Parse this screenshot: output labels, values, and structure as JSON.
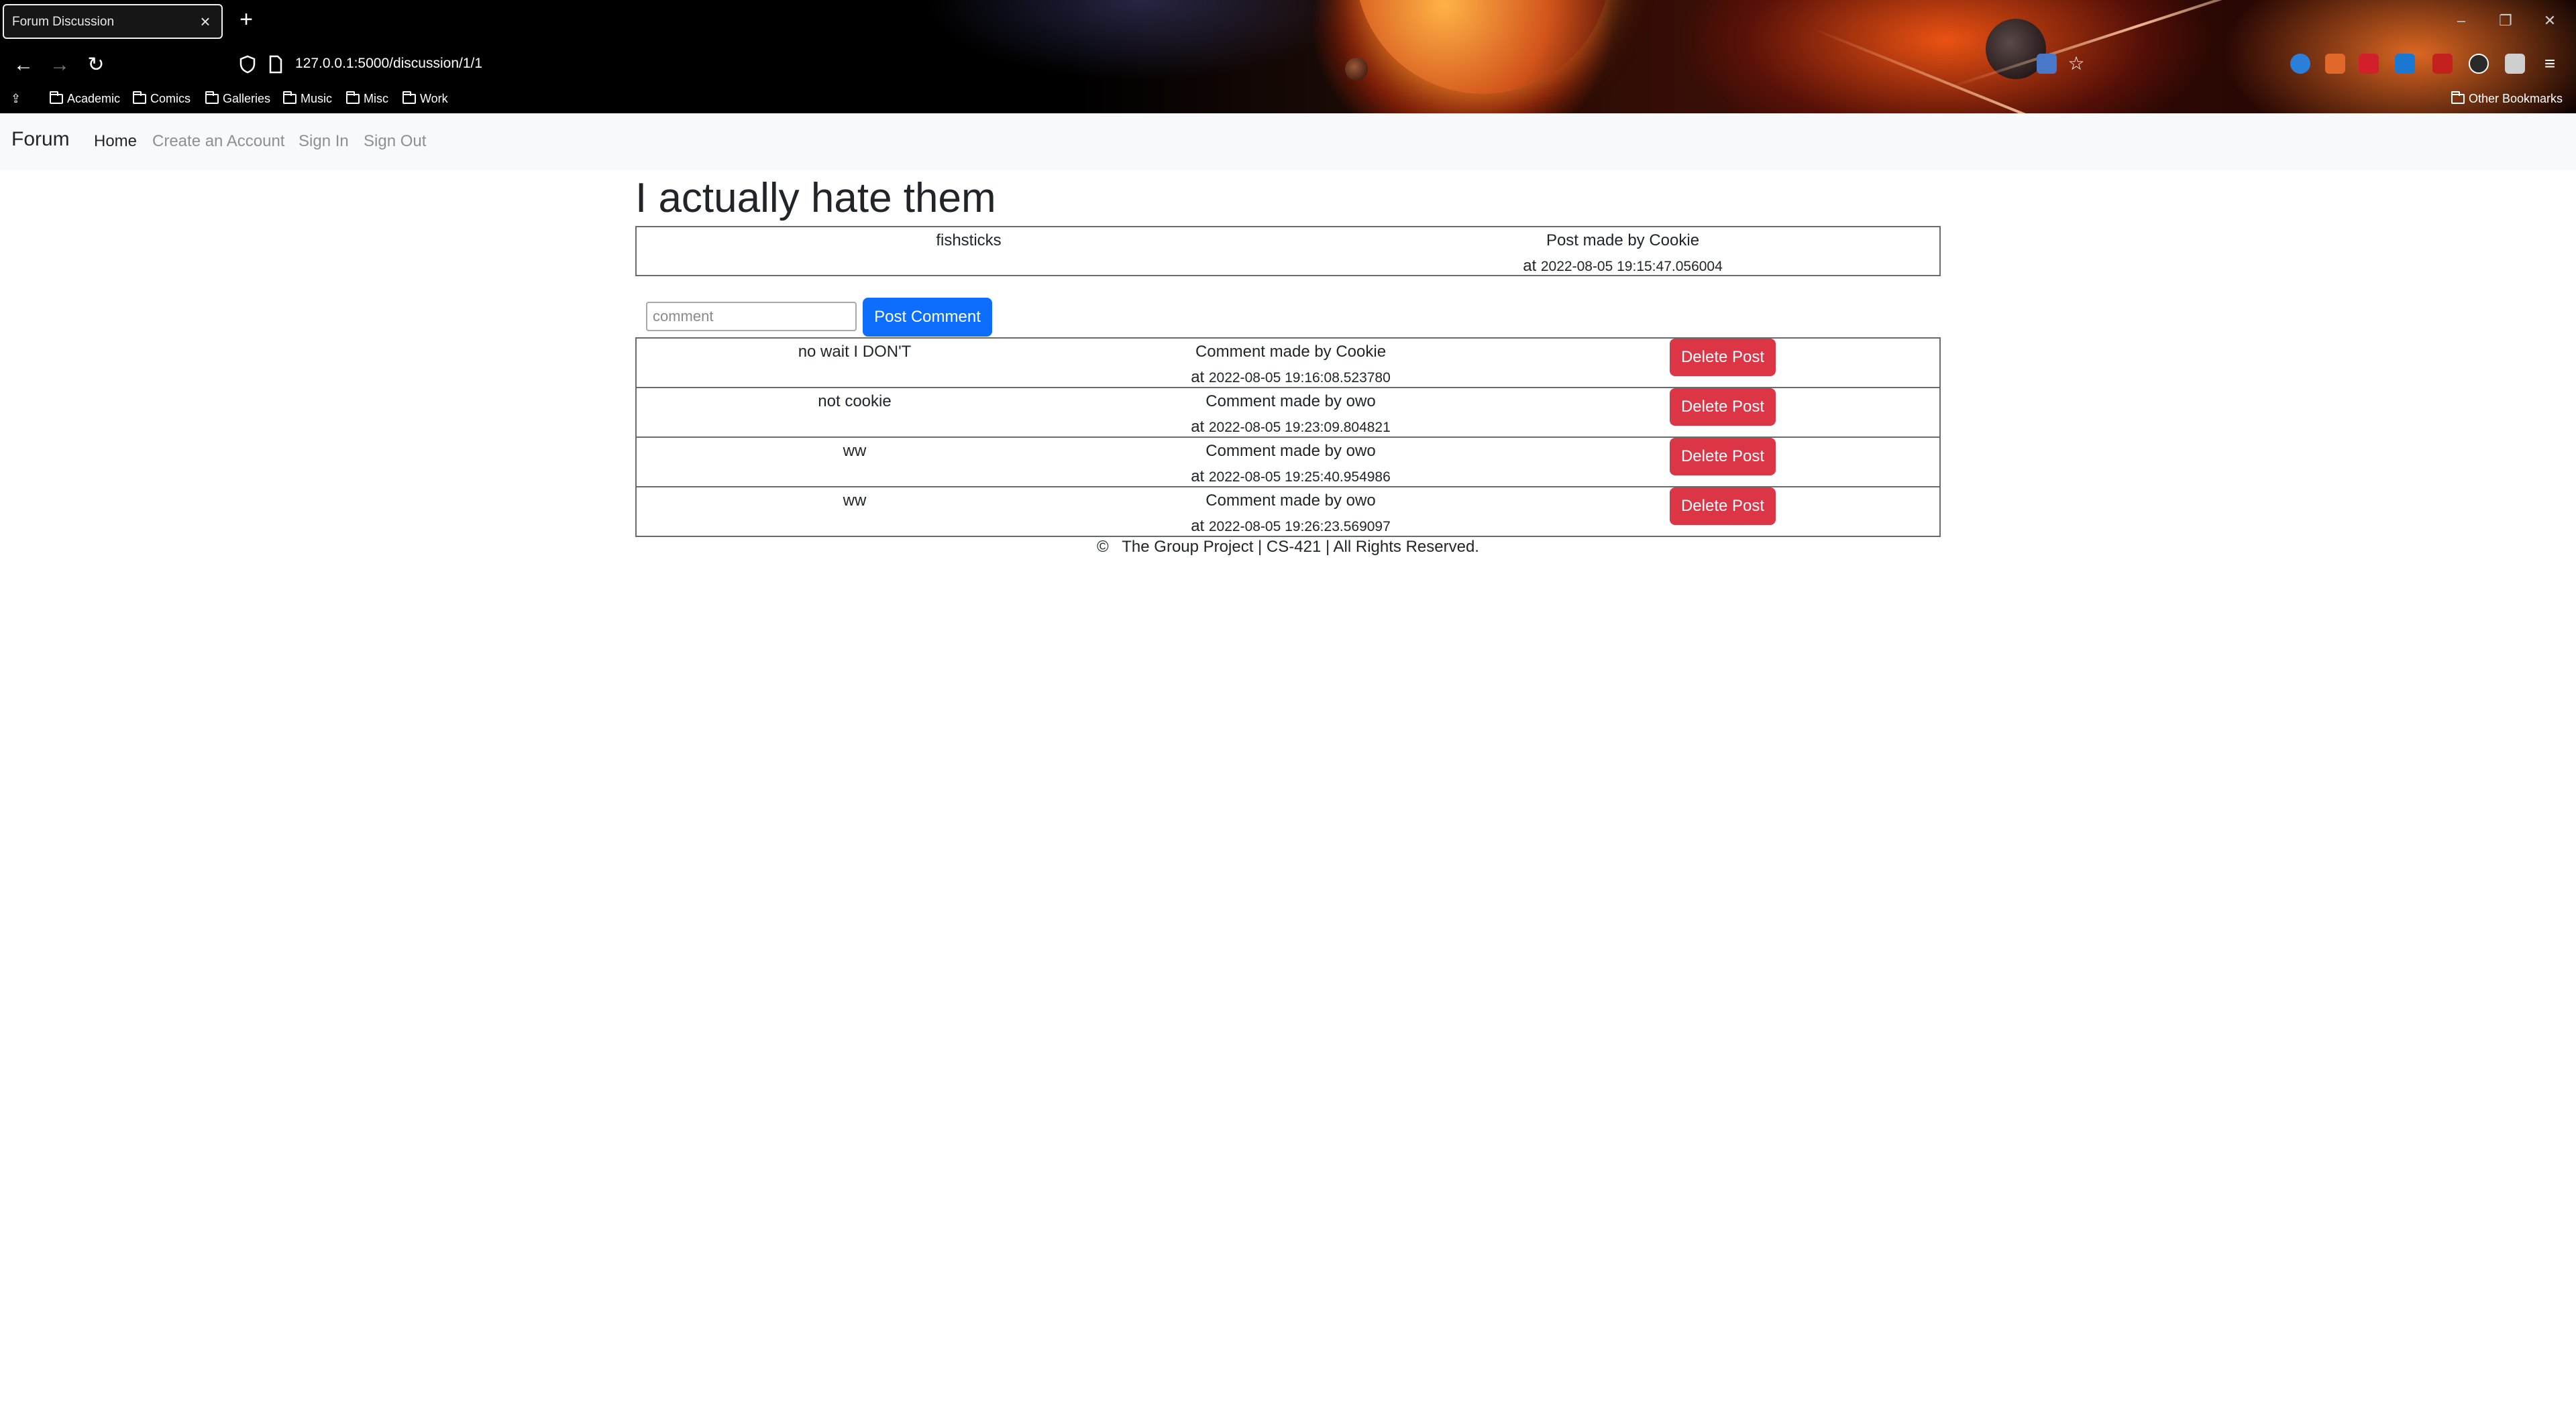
{
  "browser": {
    "tab_title": "Forum Discussion",
    "tab_close": "×",
    "new_tab": "+",
    "url": "127.0.0.1:5000/discussion/1/1",
    "bookmarks": [
      "Academic",
      "Comics",
      "Galleries",
      "Music",
      "Misc",
      "Work"
    ],
    "other_bookmarks": "Other Bookmarks"
  },
  "navbar": {
    "brand": "Forum",
    "links": [
      "Home",
      "Create an Account",
      "Sign In",
      "Sign Out"
    ]
  },
  "post": {
    "title": "I actually hate them",
    "content": "fishsticks",
    "meta_label": "Post made by Cookie",
    "at": "at",
    "timestamp": "2022-08-05 19:15:47.056004"
  },
  "comment_form": {
    "placeholder": "comment",
    "button": "Post Comment"
  },
  "comments": [
    {
      "content": "no wait I DON'T",
      "meta": "Comment made by Cookie",
      "at": "at",
      "timestamp": "2022-08-05 19:16:08.523780",
      "delete": "Delete Post"
    },
    {
      "content": "not cookie",
      "meta": "Comment made by owo",
      "at": "at",
      "timestamp": "2022-08-05 19:23:09.804821",
      "delete": "Delete Post"
    },
    {
      "content": "ww",
      "meta": "Comment made by owo",
      "at": "at",
      "timestamp": "2022-08-05 19:25:40.954986",
      "delete": "Delete Post"
    },
    {
      "content": "ww",
      "meta": "Comment made by owo",
      "at": "at",
      "timestamp": "2022-08-05 19:26:23.569097",
      "delete": "Delete Post"
    }
  ],
  "footer": "©   The Group Project | CS-421 | All Rights Reserved.",
  "colors": {
    "primary_button": "#0d6efd",
    "danger_button": "#dc3545",
    "navbar_bg": "#f8f9fa"
  }
}
